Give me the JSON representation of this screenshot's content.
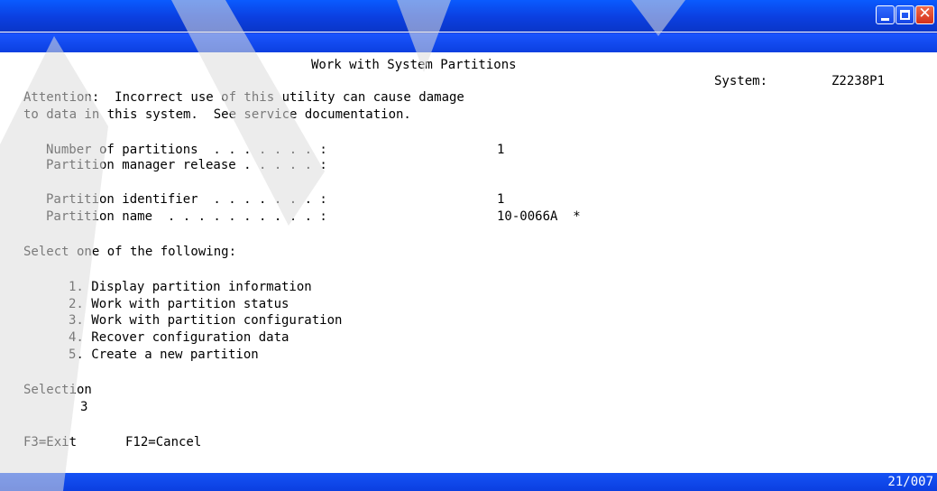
{
  "screen": {
    "title": "Work with System Partitions",
    "system_label": "System:",
    "system_name": "Z2238P1",
    "attention_line1": "Attention:  Incorrect use of this utility can cause damage",
    "attention_line2": "to data in this system.  See service documentation.",
    "fields": [
      {
        "label": "Number of partitions  . . . . . . . :",
        "value": "1"
      },
      {
        "label": "Partition manager release . . . . . :",
        "value": ""
      },
      {
        "label": "Partition identifier  . . . . . . . :",
        "value": "1"
      },
      {
        "label": "Partition name  . . . . . . . . . . :",
        "value": "10-0066A  *"
      }
    ],
    "select_prompt": "Select one of the following:",
    "options": [
      "1. Display partition information",
      "2. Work with partition status",
      "3. Work with partition configuration",
      "4. Recover configuration data",
      "5. Create a new partition"
    ],
    "selection_label": "Selection",
    "selection_value": "3",
    "function_keys": [
      {
        "label": "F3=Exit"
      },
      {
        "label": "F12=Cancel"
      }
    ]
  },
  "status_bar": {
    "cursor_position": "21/007"
  },
  "colors": {
    "titlebar": "#0b3fe0",
    "close_button": "#d4301a",
    "text": "#000000",
    "background": "#ffffff"
  }
}
